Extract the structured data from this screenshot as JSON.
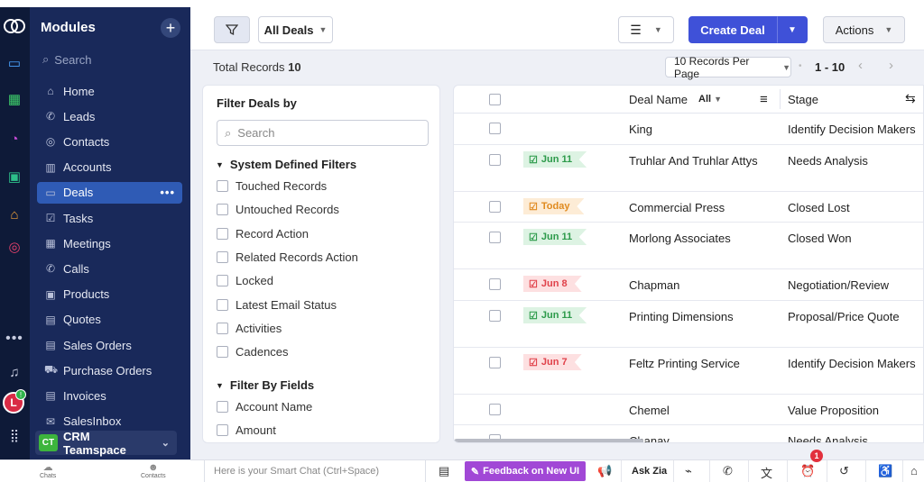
{
  "sidebar": {
    "title": "Modules",
    "search_placeholder": "Search",
    "items": [
      {
        "label": "Home",
        "icon": "home-icon"
      },
      {
        "label": "Leads",
        "icon": "leads-icon"
      },
      {
        "label": "Contacts",
        "icon": "contacts-icon"
      },
      {
        "label": "Accounts",
        "icon": "accounts-icon"
      },
      {
        "label": "Deals",
        "icon": "deals-icon",
        "active": true
      },
      {
        "label": "Tasks",
        "icon": "tasks-icon"
      },
      {
        "label": "Meetings",
        "icon": "meetings-icon"
      },
      {
        "label": "Calls",
        "icon": "calls-icon"
      },
      {
        "label": "Products",
        "icon": "products-icon"
      },
      {
        "label": "Quotes",
        "icon": "quotes-icon"
      },
      {
        "label": "Sales Orders",
        "icon": "sales-orders-icon"
      },
      {
        "label": "Purchase Orders",
        "icon": "purchase-orders-icon"
      },
      {
        "label": "Invoices",
        "icon": "invoices-icon"
      },
      {
        "label": "SalesInbox",
        "icon": "salesinbox-icon"
      }
    ],
    "teamspace": {
      "badge": "CT",
      "label": "CRM Teamspace"
    }
  },
  "rail": {
    "avatar_letter": "L",
    "avatar_badge": "!"
  },
  "toolbar": {
    "view_label": "All Deals",
    "create_label": "Create Deal",
    "actions_label": "Actions"
  },
  "listing": {
    "total_label": "Total Records",
    "total_count": "10",
    "per_page": "10 Records Per Page",
    "page_range": "1 - 10"
  },
  "filters": {
    "title": "Filter Deals by",
    "search_placeholder": "Search",
    "system_heading": "System Defined Filters",
    "system_options": [
      "Touched Records",
      "Untouched Records",
      "Record Action",
      "Related Records Action",
      "Locked",
      "Latest Email Status",
      "Activities",
      "Cadences"
    ],
    "fields_heading": "Filter By Fields",
    "field_options": [
      "Account Name",
      "Amount"
    ]
  },
  "table": {
    "col_name": "Deal Name",
    "col_name_filter": "All",
    "col_stage": "Stage",
    "rows": [
      {
        "tag": "",
        "tag_color": "",
        "name": "King",
        "stage": "Identify Decision Makers"
      },
      {
        "tag": "Jun 11",
        "tag_color": "green",
        "name": "Truhlar And Truhlar Attys",
        "stage": "Needs Analysis"
      },
      {
        "tag": "Today",
        "tag_color": "orange",
        "name": "Commercial Press",
        "stage": "Closed Lost"
      },
      {
        "tag": "Jun 11",
        "tag_color": "green",
        "name": "Morlong Associates",
        "stage": "Closed Won"
      },
      {
        "tag": "Jun 8",
        "tag_color": "red",
        "name": "Chapman",
        "stage": "Negotiation/Review"
      },
      {
        "tag": "Jun 11",
        "tag_color": "green",
        "name": "Printing Dimensions",
        "stage": "Proposal/Price Quote"
      },
      {
        "tag": "Jun 7",
        "tag_color": "red",
        "name": "Feltz Printing Service",
        "stage": "Identify Decision Makers"
      },
      {
        "tag": "",
        "tag_color": "",
        "name": "Chemel",
        "stage": "Value Proposition"
      },
      {
        "tag": "",
        "tag_color": "",
        "name": "Chanay",
        "stage": "Needs Analysis"
      }
    ]
  },
  "bottombar": {
    "chats_label": "Chats",
    "contacts_label": "Contacts",
    "smart_chat_placeholder": "Here is your Smart Chat (Ctrl+Space)",
    "feedback_label": "Feedback on New UI",
    "ask_zia_label": "Ask Zia",
    "notification_count": "1"
  },
  "colors": {
    "rail_bg": "#0e1a38",
    "sidebar_bg": "#19295a",
    "active_item": "#2f5bb5",
    "primary_button": "#3f51d8",
    "feedback_button": "#a148d6"
  }
}
